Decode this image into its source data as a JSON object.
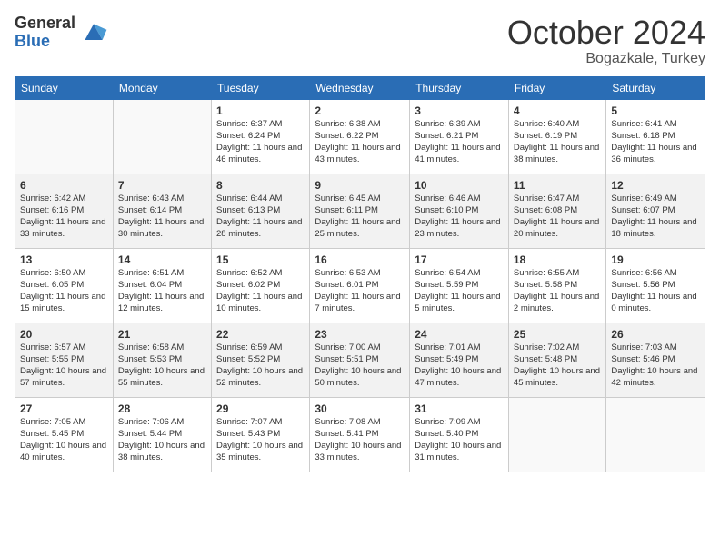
{
  "header": {
    "logo_general": "General",
    "logo_blue": "Blue",
    "month": "October 2024",
    "location": "Bogazkale, Turkey"
  },
  "weekdays": [
    "Sunday",
    "Monday",
    "Tuesday",
    "Wednesday",
    "Thursday",
    "Friday",
    "Saturday"
  ],
  "weeks": [
    [
      {
        "day": "",
        "info": ""
      },
      {
        "day": "",
        "info": ""
      },
      {
        "day": "1",
        "sunrise": "6:37 AM",
        "sunset": "6:24 PM",
        "daylight": "11 hours and 46 minutes."
      },
      {
        "day": "2",
        "sunrise": "6:38 AM",
        "sunset": "6:22 PM",
        "daylight": "11 hours and 43 minutes."
      },
      {
        "day": "3",
        "sunrise": "6:39 AM",
        "sunset": "6:21 PM",
        "daylight": "11 hours and 41 minutes."
      },
      {
        "day": "4",
        "sunrise": "6:40 AM",
        "sunset": "6:19 PM",
        "daylight": "11 hours and 38 minutes."
      },
      {
        "day": "5",
        "sunrise": "6:41 AM",
        "sunset": "6:18 PM",
        "daylight": "11 hours and 36 minutes."
      }
    ],
    [
      {
        "day": "6",
        "sunrise": "6:42 AM",
        "sunset": "6:16 PM",
        "daylight": "11 hours and 33 minutes."
      },
      {
        "day": "7",
        "sunrise": "6:43 AM",
        "sunset": "6:14 PM",
        "daylight": "11 hours and 30 minutes."
      },
      {
        "day": "8",
        "sunrise": "6:44 AM",
        "sunset": "6:13 PM",
        "daylight": "11 hours and 28 minutes."
      },
      {
        "day": "9",
        "sunrise": "6:45 AM",
        "sunset": "6:11 PM",
        "daylight": "11 hours and 25 minutes."
      },
      {
        "day": "10",
        "sunrise": "6:46 AM",
        "sunset": "6:10 PM",
        "daylight": "11 hours and 23 minutes."
      },
      {
        "day": "11",
        "sunrise": "6:47 AM",
        "sunset": "6:08 PM",
        "daylight": "11 hours and 20 minutes."
      },
      {
        "day": "12",
        "sunrise": "6:49 AM",
        "sunset": "6:07 PM",
        "daylight": "11 hours and 18 minutes."
      }
    ],
    [
      {
        "day": "13",
        "sunrise": "6:50 AM",
        "sunset": "6:05 PM",
        "daylight": "11 hours and 15 minutes."
      },
      {
        "day": "14",
        "sunrise": "6:51 AM",
        "sunset": "6:04 PM",
        "daylight": "11 hours and 12 minutes."
      },
      {
        "day": "15",
        "sunrise": "6:52 AM",
        "sunset": "6:02 PM",
        "daylight": "11 hours and 10 minutes."
      },
      {
        "day": "16",
        "sunrise": "6:53 AM",
        "sunset": "6:01 PM",
        "daylight": "11 hours and 7 minutes."
      },
      {
        "day": "17",
        "sunrise": "6:54 AM",
        "sunset": "5:59 PM",
        "daylight": "11 hours and 5 minutes."
      },
      {
        "day": "18",
        "sunrise": "6:55 AM",
        "sunset": "5:58 PM",
        "daylight": "11 hours and 2 minutes."
      },
      {
        "day": "19",
        "sunrise": "6:56 AM",
        "sunset": "5:56 PM",
        "daylight": "11 hours and 0 minutes."
      }
    ],
    [
      {
        "day": "20",
        "sunrise": "6:57 AM",
        "sunset": "5:55 PM",
        "daylight": "10 hours and 57 minutes."
      },
      {
        "day": "21",
        "sunrise": "6:58 AM",
        "sunset": "5:53 PM",
        "daylight": "10 hours and 55 minutes."
      },
      {
        "day": "22",
        "sunrise": "6:59 AM",
        "sunset": "5:52 PM",
        "daylight": "10 hours and 52 minutes."
      },
      {
        "day": "23",
        "sunrise": "7:00 AM",
        "sunset": "5:51 PM",
        "daylight": "10 hours and 50 minutes."
      },
      {
        "day": "24",
        "sunrise": "7:01 AM",
        "sunset": "5:49 PM",
        "daylight": "10 hours and 47 minutes."
      },
      {
        "day": "25",
        "sunrise": "7:02 AM",
        "sunset": "5:48 PM",
        "daylight": "10 hours and 45 minutes."
      },
      {
        "day": "26",
        "sunrise": "7:03 AM",
        "sunset": "5:46 PM",
        "daylight": "10 hours and 42 minutes."
      }
    ],
    [
      {
        "day": "27",
        "sunrise": "7:05 AM",
        "sunset": "5:45 PM",
        "daylight": "10 hours and 40 minutes."
      },
      {
        "day": "28",
        "sunrise": "7:06 AM",
        "sunset": "5:44 PM",
        "daylight": "10 hours and 38 minutes."
      },
      {
        "day": "29",
        "sunrise": "7:07 AM",
        "sunset": "5:43 PM",
        "daylight": "10 hours and 35 minutes."
      },
      {
        "day": "30",
        "sunrise": "7:08 AM",
        "sunset": "5:41 PM",
        "daylight": "10 hours and 33 minutes."
      },
      {
        "day": "31",
        "sunrise": "7:09 AM",
        "sunset": "5:40 PM",
        "daylight": "10 hours and 31 minutes."
      },
      {
        "day": "",
        "info": ""
      },
      {
        "day": "",
        "info": ""
      }
    ]
  ],
  "labels": {
    "sunrise": "Sunrise:",
    "sunset": "Sunset:",
    "daylight": "Daylight:"
  }
}
